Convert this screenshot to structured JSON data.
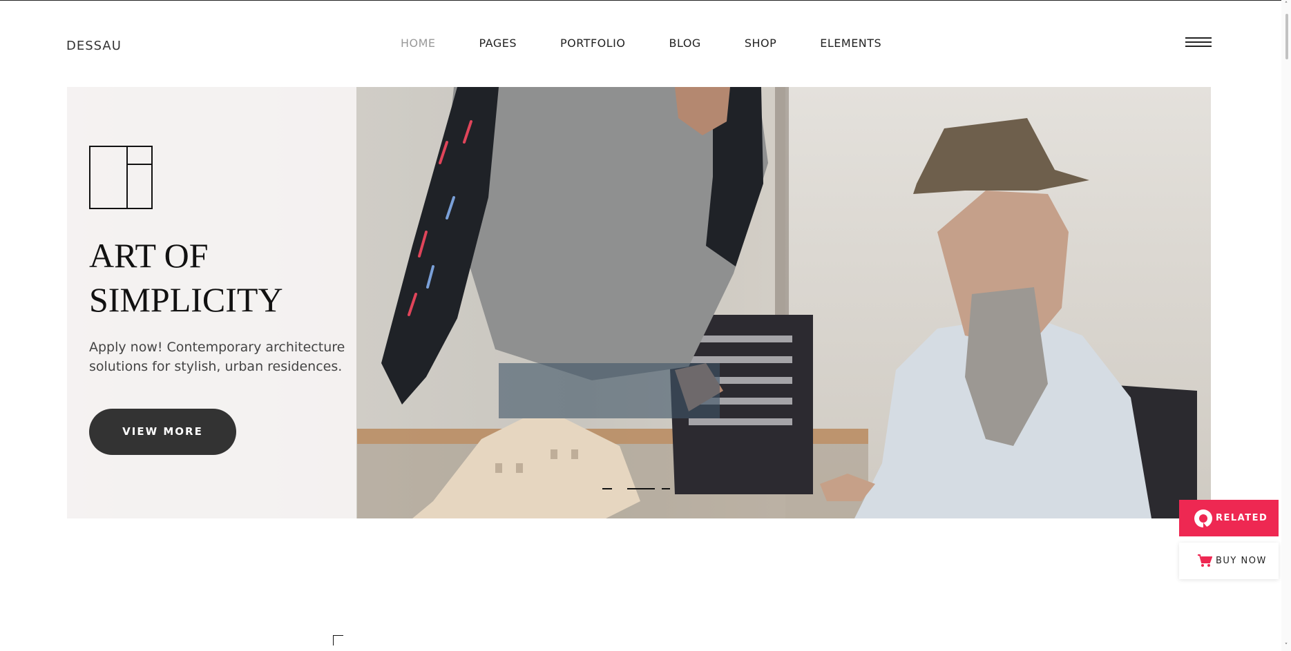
{
  "header": {
    "logo": "DESSAU",
    "nav": [
      {
        "label": "HOME",
        "active": true
      },
      {
        "label": "PAGES"
      },
      {
        "label": "PORTFOLIO"
      },
      {
        "label": "BLOG"
      },
      {
        "label": "SHOP"
      },
      {
        "label": "ELEMENTS"
      }
    ],
    "menu_icon": "hamburger-icon"
  },
  "hero": {
    "icon": "layout-grid-icon",
    "title_line1": "ART OF",
    "title_line2": "SIMPLICITY",
    "description": "Apply now! Contemporary architecture solutions for stylish, urban residences.",
    "button_label": "VIEW MORE",
    "slider": {
      "count": 3,
      "active_index": 1
    }
  },
  "floating": {
    "related_label": "RELATED",
    "related_icon": "circle-logo-icon",
    "buy_label": "BUY NOW",
    "buy_icon": "cart-icon"
  },
  "colors": {
    "accent": "#ee2852",
    "button_dark": "#333333",
    "active_nav": "#999999"
  }
}
